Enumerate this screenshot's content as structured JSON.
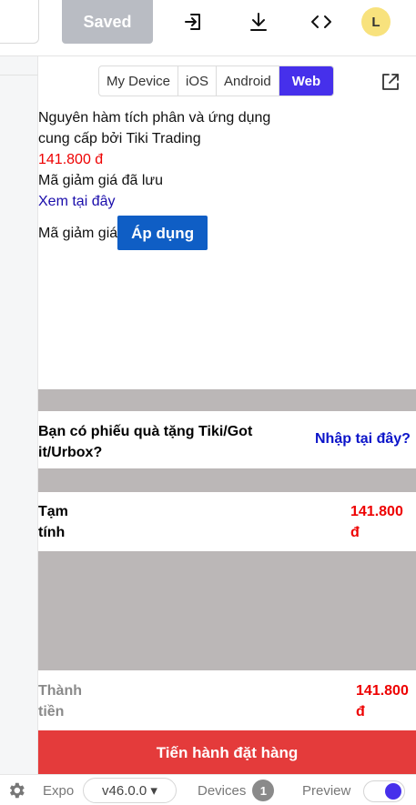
{
  "toolbar": {
    "saved_label": "Saved",
    "icons": [
      "sign-in-icon",
      "download-icon",
      "code-icon"
    ],
    "avatar_initial": "L"
  },
  "device_tabs": {
    "items": [
      {
        "label": "My Device",
        "active": false
      },
      {
        "label": "iOS",
        "active": false
      },
      {
        "label": "Android",
        "active": false
      },
      {
        "label": "Web",
        "active": true
      }
    ],
    "accent_color": "#4630eb"
  },
  "preview": {
    "product_title": "Nguyên hàm tích phân và ứng dụng",
    "seller": "cung cấp bởi Tiki Trading",
    "price": "141.800 đ",
    "saved_coupon_text": "Mã giảm giá đã lưu",
    "view_link": "Xem tại đây",
    "coupon_label": "Mã giảm giá",
    "apply_button": "Áp dụng",
    "gift_question": "Bạn có phiếu quà tặng Tiki/Got it/Urbox?",
    "gift_link": "Nhập tại đây?",
    "subtotal_label": "Tạm tính",
    "subtotal_value": "141.800 đ",
    "total_label": "Thành tiền",
    "total_value": "141.800 đ",
    "checkout_button": "Tiến hành đặt hàng"
  },
  "statusbar": {
    "expo_label": "Expo",
    "version": "v46.0.0 ▾",
    "devices_label": "Devices",
    "devices_count": "1",
    "preview_label": "Preview",
    "preview_on": true
  }
}
